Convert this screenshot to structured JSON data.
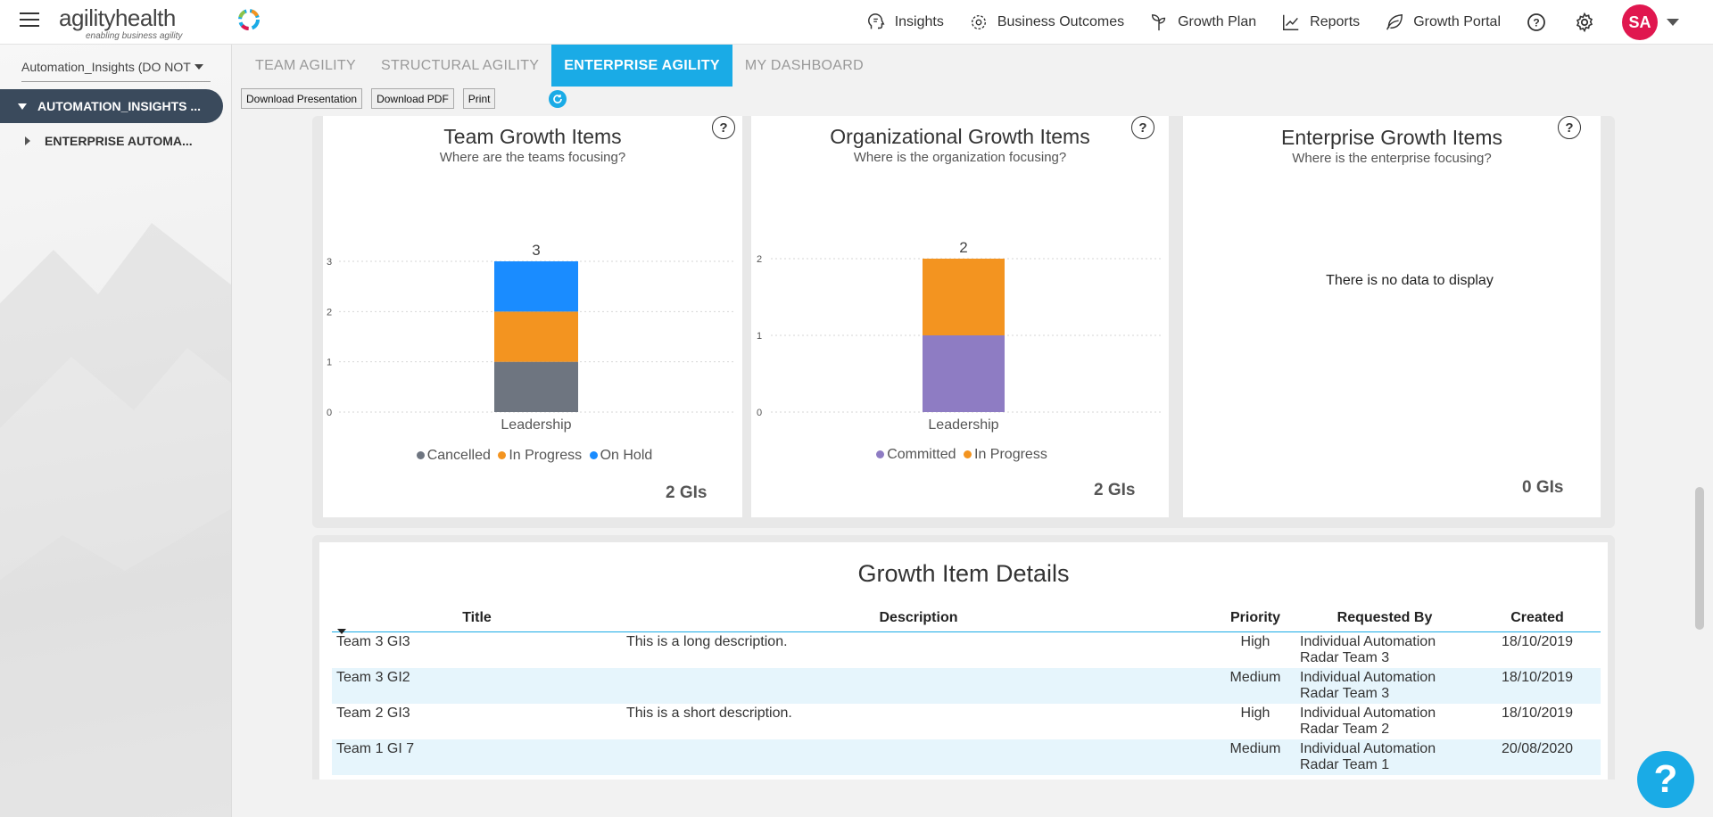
{
  "header": {
    "logo_main": "agilityhealth",
    "logo_tag": "enabling business agility",
    "nav": [
      {
        "label": "Insights",
        "icon": "head-brain-icon"
      },
      {
        "label": "Business Outcomes",
        "icon": "target-icon"
      },
      {
        "label": "Growth Plan",
        "icon": "sprout-icon"
      },
      {
        "label": "Reports",
        "icon": "line-chart-icon"
      },
      {
        "label": "Growth Portal",
        "icon": "leaf-icon"
      }
    ],
    "avatar_initials": "SA"
  },
  "sidebar": {
    "team_select": "Automation_Insights (DO NOT",
    "tree_root": "AUTOMATION_INSIGHTS ...",
    "tree_child": "ENTERPRISE AUTOMA..."
  },
  "tabs": [
    {
      "label": "TEAM AGILITY",
      "active": false
    },
    {
      "label": "STRUCTURAL AGILITY",
      "active": false
    },
    {
      "label": "ENTERPRISE AGILITY",
      "active": true
    },
    {
      "label": "MY DASHBOARD",
      "active": false
    }
  ],
  "toolbar": {
    "download_presentation": "Download Presentation",
    "download_pdf": "Download PDF",
    "print": "Print"
  },
  "cards": {
    "team": {
      "title": "Team Growth Items",
      "subtitle": "Where are the teams focusing?",
      "count": "2 GIs",
      "help": "?"
    },
    "org": {
      "title": "Organizational Growth Items",
      "subtitle": "Where is the organization focusing?",
      "count": "2 GIs",
      "help": "?"
    },
    "enterprise": {
      "title": "Enterprise Growth Items",
      "subtitle": "Where is the enterprise focusing?",
      "no_data": "There is no data to display",
      "count": "0 GIs",
      "help": "?"
    }
  },
  "chart_data": [
    {
      "type": "bar",
      "stacked": true,
      "title": "Team Growth Items",
      "subtitle": "Where are the teams focusing?",
      "categories": [
        "Leadership"
      ],
      "series": [
        {
          "name": "Cancelled",
          "values": [
            1
          ],
          "color": "#6e7580"
        },
        {
          "name": "In Progress",
          "values": [
            1
          ],
          "color": "#f39420"
        },
        {
          "name": "On Hold",
          "values": [
            1
          ],
          "color": "#1a8cff"
        }
      ],
      "totals": [
        3
      ],
      "yticks": [
        0,
        1,
        2,
        3
      ],
      "ylim": [
        0,
        3
      ],
      "grid": true,
      "legend": "bottom"
    },
    {
      "type": "bar",
      "stacked": true,
      "title": "Organizational Growth Items",
      "subtitle": "Where is the organization focusing?",
      "categories": [
        "Leadership"
      ],
      "series": [
        {
          "name": "Committed",
          "values": [
            1
          ],
          "color": "#8e7cc3"
        },
        {
          "name": "In Progress",
          "values": [
            1
          ],
          "color": "#f39420"
        }
      ],
      "totals": [
        2
      ],
      "yticks": [
        0,
        1,
        2
      ],
      "ylim": [
        0,
        2
      ],
      "grid": true,
      "legend": "bottom"
    }
  ],
  "details": {
    "title": "Growth Item Details",
    "columns": [
      "Title",
      "Description",
      "Priority",
      "Requested By",
      "Created"
    ],
    "rows": [
      {
        "title": "Team 3 GI3",
        "description": "This is a long description.",
        "priority": "High",
        "requested_by_1": "Individual Automation",
        "requested_by_2": "Radar Team 3",
        "created": "18/10/2019"
      },
      {
        "title": "Team 3 GI2",
        "description": "",
        "priority": "Medium",
        "requested_by_1": "Individual Automation",
        "requested_by_2": "Radar Team 3",
        "created": "18/10/2019"
      },
      {
        "title": "Team 2 GI3",
        "description": "This is a short description.",
        "priority": "High",
        "requested_by_1": "Individual Automation",
        "requested_by_2": "Radar Team 2",
        "created": "18/10/2019"
      },
      {
        "title": "Team 1 GI 7",
        "description": "",
        "priority": "Medium",
        "requested_by_1": "Individual Automation",
        "requested_by_2": "Radar Team 1",
        "created": "20/08/2020"
      }
    ]
  },
  "help_fab": "?"
}
